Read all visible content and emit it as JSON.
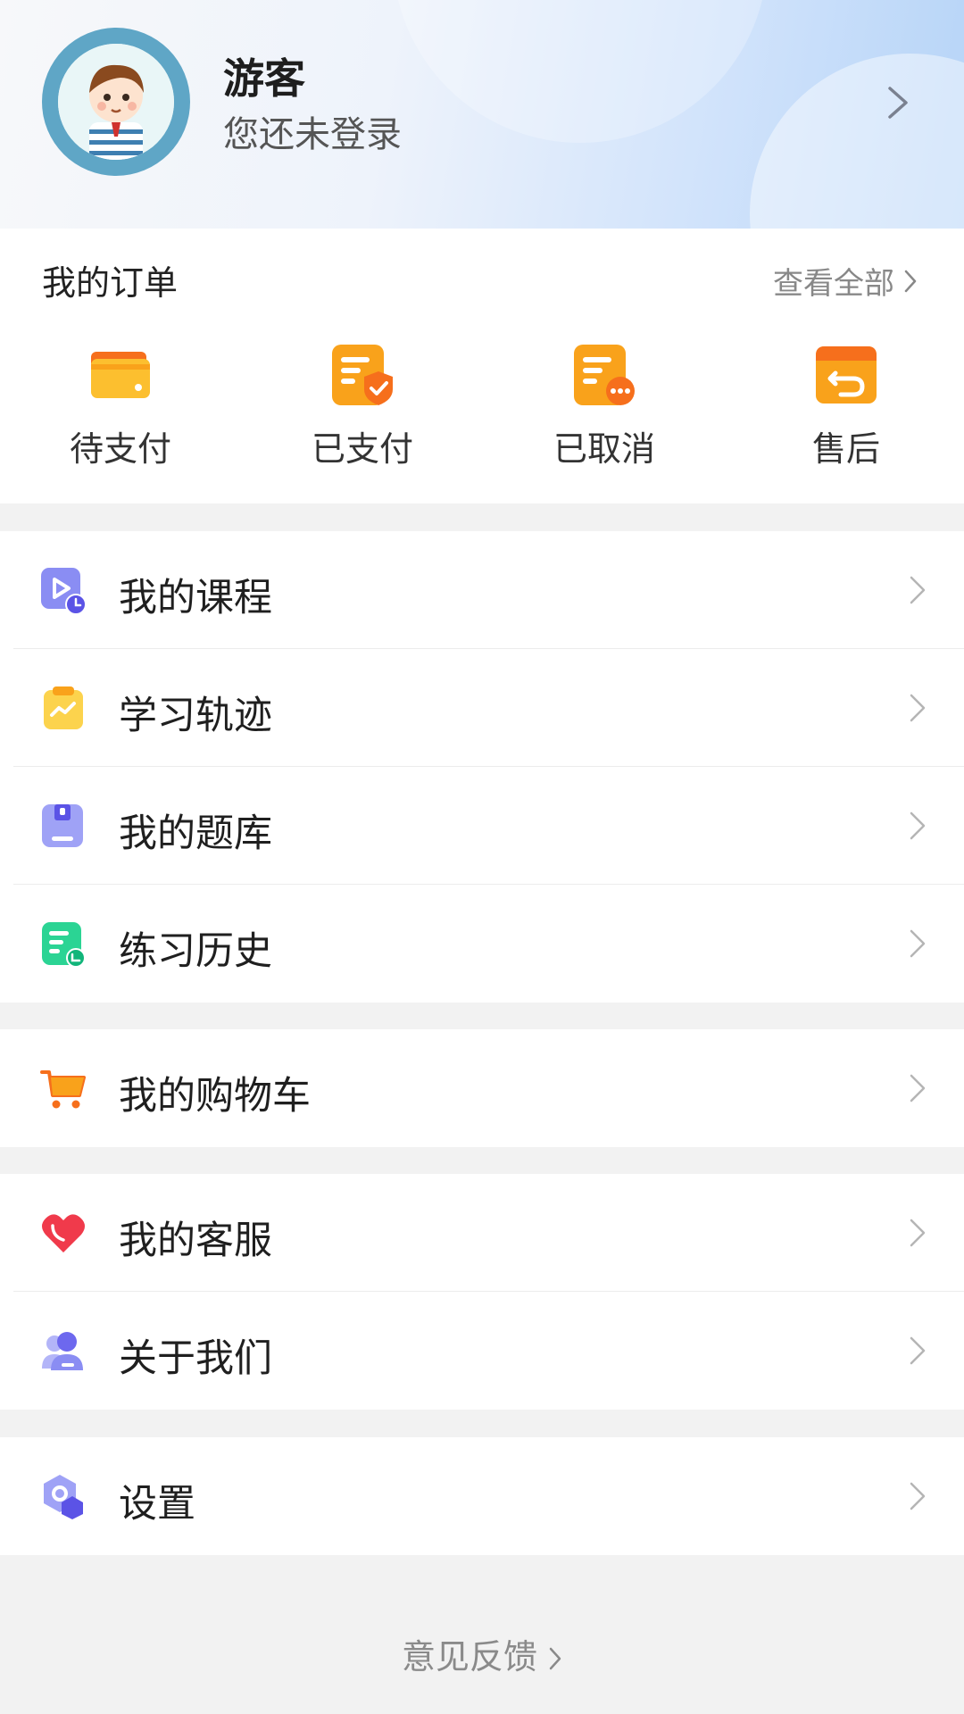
{
  "profile": {
    "name": "游客",
    "status": "您还未登录"
  },
  "orders": {
    "title": "我的订单",
    "view_all": "查看全部",
    "items": [
      {
        "label": "待支付",
        "icon": "wallet-icon"
      },
      {
        "label": "已支付",
        "icon": "paid-doc-icon"
      },
      {
        "label": "已取消",
        "icon": "cancelled-doc-icon"
      },
      {
        "label": "售后",
        "icon": "return-box-icon"
      }
    ]
  },
  "menu_groups": [
    {
      "items": [
        {
          "label": "我的课程",
          "icon": "video-course-icon"
        },
        {
          "label": "学习轨迹",
          "icon": "clipboard-chart-icon"
        },
        {
          "label": "我的题库",
          "icon": "question-bank-icon"
        },
        {
          "label": "练习历史",
          "icon": "history-doc-icon"
        }
      ]
    },
    {
      "items": [
        {
          "label": "我的购物车",
          "icon": "shopping-cart-icon"
        }
      ]
    },
    {
      "items": [
        {
          "label": "我的客服",
          "icon": "heart-phone-icon"
        },
        {
          "label": "关于我们",
          "icon": "people-icon"
        }
      ]
    },
    {
      "items": [
        {
          "label": "设置",
          "icon": "settings-hexagon-icon"
        }
      ]
    }
  ],
  "feedback": "意见反馈",
  "colors": {
    "orange": "#f9a21b",
    "orange_dark": "#f66f1c",
    "purple": "#8a8df3",
    "green": "#2bd494",
    "red": "#f03a4b"
  }
}
